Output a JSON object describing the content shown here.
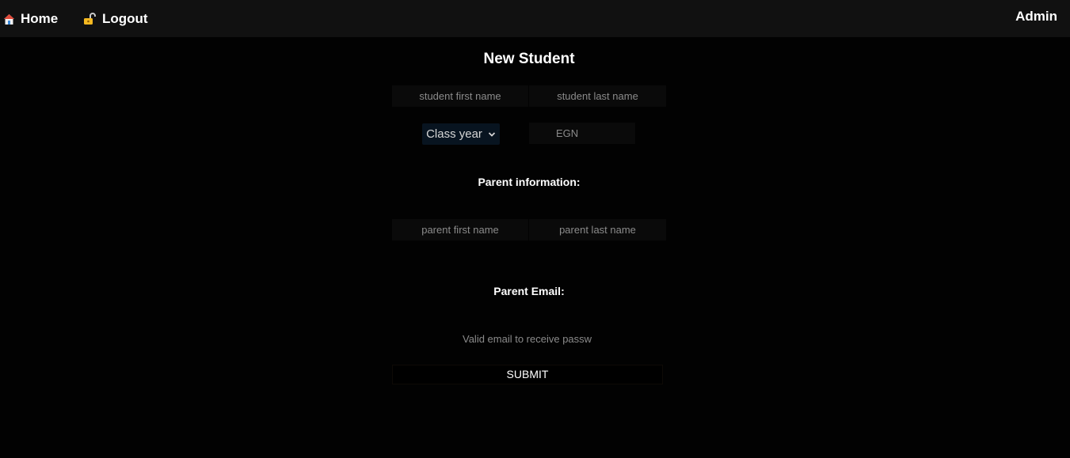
{
  "navbar": {
    "home_label": "Home",
    "logout_label": "Logout",
    "user_label": "Admin"
  },
  "form": {
    "title": "New Student",
    "student_first_name_placeholder": "student first name",
    "student_last_name_placeholder": "student last name",
    "class_year_selected": "Class year",
    "egn_placeholder": "EGN",
    "parent_info_label": "Parent information:",
    "parent_first_name_placeholder": "parent first name",
    "parent_last_name_placeholder": "parent last name",
    "parent_email_label": "Parent Email:",
    "parent_email_placeholder": "Valid email to receive passw",
    "submit_label": "SUBMIT"
  },
  "colors": {
    "page_background": "#020202",
    "navbar_background": "#111111",
    "select_background": "#081420",
    "input_background": "#0a0a0a",
    "placeholder_text": "#8b8b8b"
  }
}
